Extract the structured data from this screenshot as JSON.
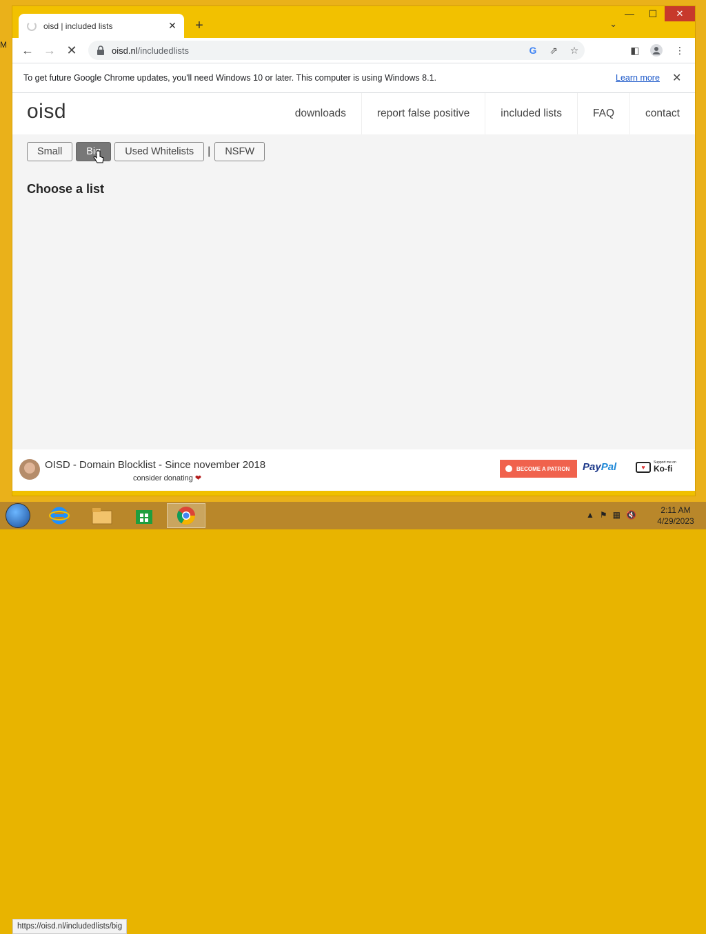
{
  "desktop": {
    "edge_letter": "M"
  },
  "browser": {
    "tab": {
      "title": "oisd | included lists"
    },
    "omnibox": {
      "url_host": "oisd.nl",
      "url_path": "/includedlists"
    },
    "infobar": {
      "message": "To get future Google Chrome updates, you'll need Windows 10 or later. This computer is using Windows 8.1.",
      "link": "Learn more"
    },
    "status_url": "https://oisd.nl/includedlists/big"
  },
  "site": {
    "logo": "oisd",
    "nav": [
      "downloads",
      "report false positive",
      "included lists",
      "FAQ",
      "contact"
    ],
    "list_buttons": {
      "small": "Small",
      "big": "Big",
      "used_whitelists": "Used Whitelists",
      "separator": "|",
      "nsfw": "NSFW"
    },
    "heading": "Choose a list",
    "footer": {
      "title": "OISD - Domain Blocklist - Since november 2018",
      "subtitle": "consider donating",
      "patreon": "BECOME A PATRON",
      "paypal_1": "Pay",
      "paypal_2": "Pal",
      "kofi_small": "Support me on",
      "kofi": "Ko-fi"
    }
  },
  "taskbar": {
    "time": "2:11 AM",
    "date": "4/29/2023"
  }
}
